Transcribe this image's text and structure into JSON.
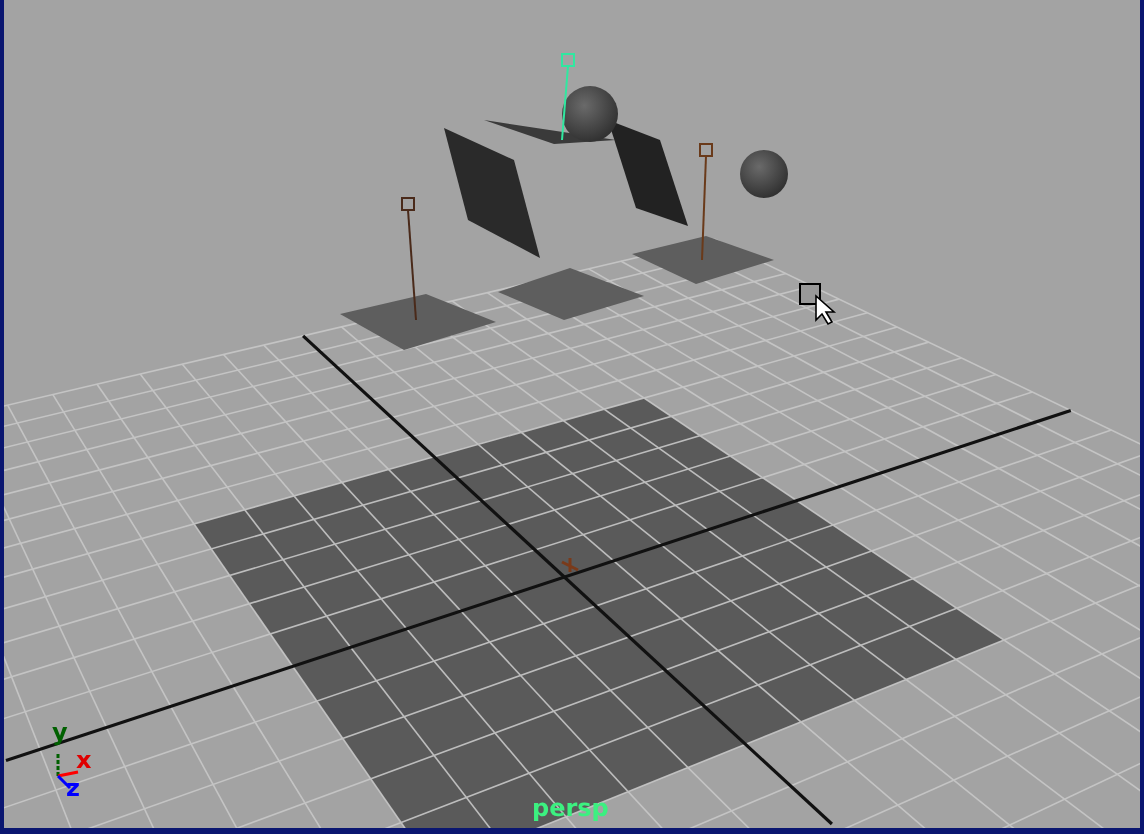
{
  "viewport": {
    "camera_label": "persp",
    "axis_labels": [
      {
        "axis": "x",
        "color": "#e00000"
      },
      {
        "axis": "y",
        "color": "#006000"
      },
      {
        "axis": "z",
        "color": "#0000ff"
      }
    ]
  }
}
